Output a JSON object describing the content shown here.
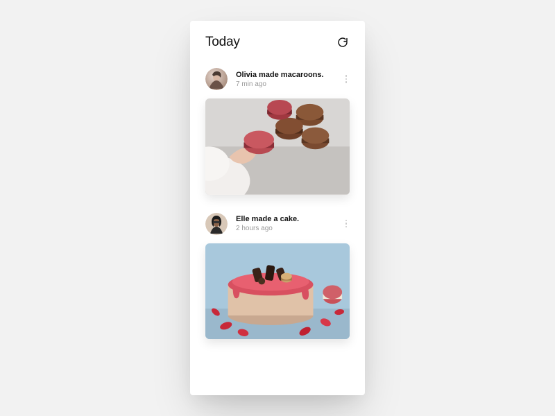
{
  "header": {
    "title": "Today",
    "refresh_icon": "refresh-icon"
  },
  "feed": {
    "posts": [
      {
        "avatar_label": "Olivia avatar",
        "title": "Olivia made macaroons.",
        "time": "7 min ago",
        "image_alt": "macaroons",
        "more_label": "more"
      },
      {
        "avatar_label": "Elle avatar",
        "title": "Elle made a cake.",
        "time": "2 hours ago",
        "image_alt": "cake",
        "more_label": "more"
      }
    ]
  },
  "colors": {
    "background": "#f2f2f2",
    "card": "#ffffff",
    "text": "#111111",
    "muted": "#9a9a9a"
  }
}
